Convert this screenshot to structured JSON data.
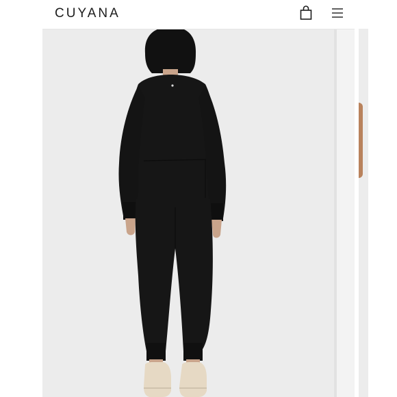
{
  "header": {
    "brand": "CUYANA",
    "bag_icon": "shopping-bag-icon",
    "menu_icon": "hamburger-menu-icon"
  },
  "product_image": {
    "subject": "model-back-view-black-sweatshirt-and-joggers"
  },
  "colors": {
    "background": "#ececec",
    "garment": "#161616",
    "skin": "#caa58c",
    "sneaker": "#e8dcc8",
    "brand_text": "#1c1c1c"
  }
}
